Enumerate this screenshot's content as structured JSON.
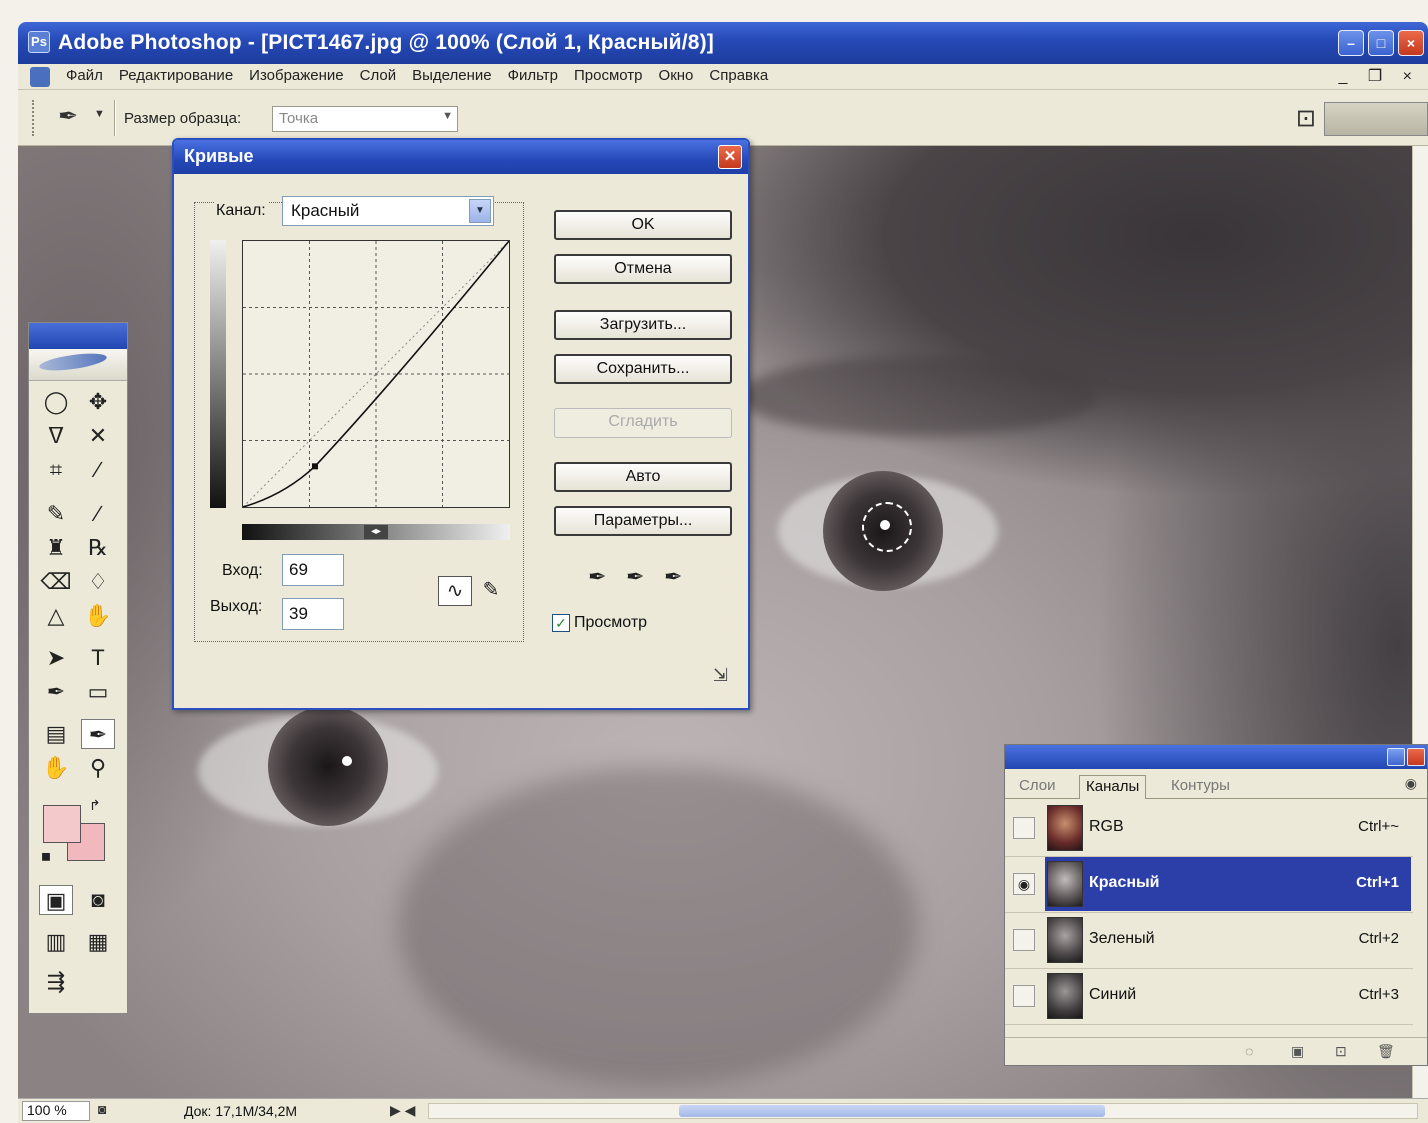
{
  "window": {
    "title": "Adobe Photoshop - [PICT1467.jpg @ 100% (Слой 1, Красный/8)]",
    "controls": [
      "–",
      "□",
      "×"
    ]
  },
  "menu": {
    "items": [
      "Файл",
      "Редактирование",
      "Изображение",
      "Слой",
      "Выделение",
      "Фильтр",
      "Просмотр",
      "Окно",
      "Справка"
    ],
    "mdi_controls": "_ ❐ ×"
  },
  "options_bar": {
    "sample_size_label": "Размер образца:",
    "sample_size_value": "Точка"
  },
  "curves": {
    "title": "Кривые",
    "channel_label": "Канал:",
    "channel_value": "Красный",
    "input_label": "Вход:",
    "input_value": "69",
    "output_label": "Выход:",
    "output_value": "39",
    "buttons": {
      "ok": "OK",
      "cancel": "Отмена",
      "load": "Загрузить...",
      "save": "Сохранить...",
      "smooth": "Сгладить",
      "auto": "Авто",
      "options": "Параметры..."
    },
    "preview_label": "Просмотр",
    "preview_checked": true,
    "curve_points": [
      [
        0,
        0
      ],
      [
        69,
        39
      ],
      [
        255,
        255
      ]
    ]
  },
  "channels_panel": {
    "tabs": [
      "Слои",
      "Каналы",
      "Контуры"
    ],
    "active_tab": "Каналы",
    "rows": [
      {
        "name": "RGB",
        "shortcut": "Ctrl+~",
        "visible": false,
        "selected": false
      },
      {
        "name": "Красный",
        "shortcut": "Ctrl+1",
        "visible": true,
        "selected": true
      },
      {
        "name": "Зеленый",
        "shortcut": "Ctrl+2",
        "visible": false,
        "selected": false
      },
      {
        "name": "Синий",
        "shortcut": "Ctrl+3",
        "visible": false,
        "selected": false
      }
    ],
    "selected_color": "#2c3fa8"
  },
  "status": {
    "zoom": "100 %",
    "doc": "Док: 17,1M/34,2M"
  },
  "colors": {
    "foreground": "#f4c9cc",
    "background": "#f1b8bd",
    "titlebar": "#2549b6"
  }
}
